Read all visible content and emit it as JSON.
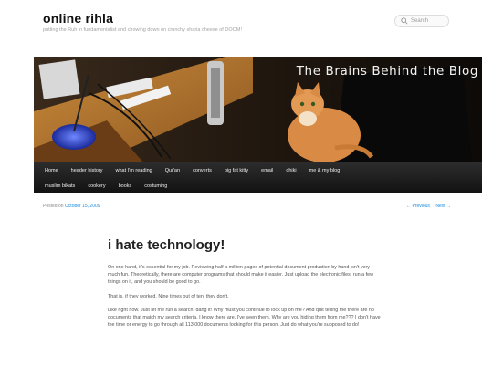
{
  "header": {
    "site_title": "online rihla",
    "site_description": "putting the Ruh in fundamentalist and chowing down on crunchy sharia cheese of DOOM!",
    "search_placeholder": "Search"
  },
  "banner": {
    "text": "The Brains Behind the Blog"
  },
  "nav": {
    "row1": [
      "Home",
      "header history",
      "what I'm reading",
      "Qur'an",
      "converts",
      "big fat kitty",
      "email",
      "dhiki",
      "me & my blog"
    ],
    "row2": [
      "muslim bikats",
      "cookery",
      "books",
      "costuming"
    ]
  },
  "post": {
    "posted_on": "Posted on",
    "date": "October 15, 2009",
    "prev": "← Previous",
    "next": "Next →",
    "title": "i hate technology!",
    "paragraphs": [
      "On one hand, it's essential for my job. Reviewing half a million pages of potential document production by hand isn't very much fun. Theoretically, there are computer programs that should make it easier. Just upload the electronic files, run a few things on it, and you should be good to go.",
      "That is, if they worked. Nine times out of ten, they don't.",
      "Like right now. Just let me run a search, dang it! Why must you continue to lock up on me? And quit telling me there are no documents that match my search criteria. I know there are. I've seen them. Why are you hiding them from me??? I don't have the time or energy to go through all 113,000 documents looking for this person. Just do what you're supposed to do!"
    ]
  },
  "colors": {
    "nav_background": "#1a1a1a",
    "link": "#1b8be0",
    "text": "#373737"
  }
}
